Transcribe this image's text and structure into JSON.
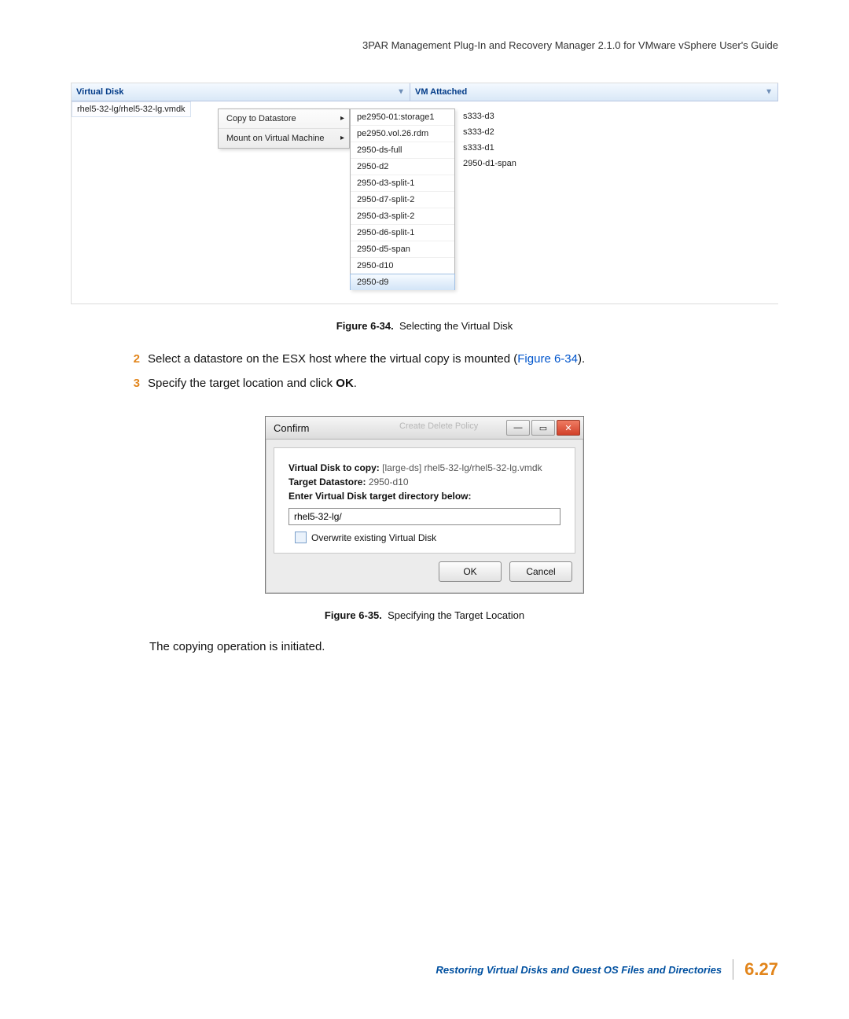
{
  "doc": {
    "header_title": "3PAR Management Plug-In and Recovery Manager 2.1.0 for VMware vSphere User's Guide",
    "footer_text": "Restoring Virtual Disks and Guest OS Files and Directories",
    "page_number": "6.27"
  },
  "fig34": {
    "col1_label": "Virtual Disk",
    "col2_label": "VM Attached",
    "virtual_disk_row": "rhel5-32-lg/rhel5-32-lg.vmdk",
    "context_menu": {
      "item1": "Copy to Datastore",
      "item2": "Mount on Virtual Machine"
    },
    "datastores_col1": [
      "pe2950-01:storage1",
      "pe2950.vol.26.rdm",
      "2950-ds-full",
      "2950-d2",
      "2950-d3-split-1",
      "2950-d7-split-2",
      "2950-d3-split-2",
      "2950-d6-split-1",
      "2950-d5-span",
      "2950-d10",
      "2950-d9"
    ],
    "datastores_col2": [
      "s333-d3",
      "s333-d2",
      "s333-d1",
      "2950-d1-span"
    ],
    "caption_label": "Figure 6-34.",
    "caption_text": "Selecting the Virtual Disk"
  },
  "steps": {
    "s2_num": "2",
    "s2_text_a": "Select a datastore on the ESX host where the virtual copy is mounted (",
    "s2_figref": "Figure 6-34",
    "s2_text_b": ").",
    "s3_num": "3",
    "s3_text_a": "Specify the target location and click ",
    "s3_bold": "OK",
    "s3_text_b": "."
  },
  "fig35": {
    "title": "Confirm",
    "ghost_menu": "Create    Delete    Policy",
    "vd_label": "Virtual Disk to copy:",
    "vd_value": "[large-ds] rhel5-32-lg/rhel5-32-lg.vmdk",
    "td_label": "Target Datastore:",
    "td_value": "2950-d10",
    "dir_label": "Enter Virtual Disk target directory below:",
    "dir_value": "rhel5-32-lg/",
    "overwrite_label": "Overwrite existing Virtual Disk",
    "ok": "OK",
    "cancel": "Cancel",
    "caption_label": "Figure 6-35.",
    "caption_text": "Specifying the Target Location"
  },
  "post_text": "The copying operation is initiated."
}
